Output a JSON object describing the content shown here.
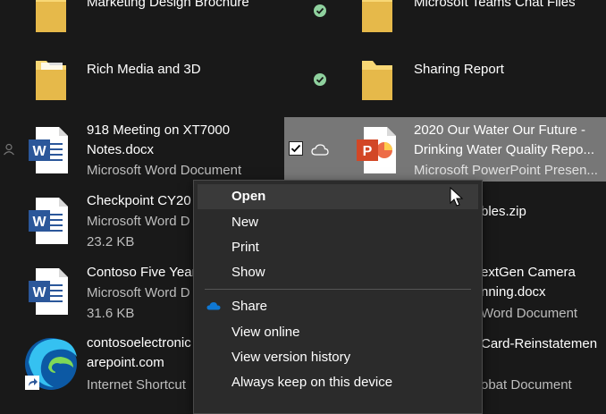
{
  "left_column": {
    "rows": [
      {
        "name_line1": "Marketing Design Brochure"
      },
      {
        "name_line1": "Rich Media and 3D"
      },
      {
        "name_line1": "918 Meeting on XT7000",
        "name_line2": "Notes.docx",
        "type": "Microsoft Word Document"
      },
      {
        "name_line1": "Checkpoint CY20",
        "type": "Microsoft Word D",
        "size": "23.2 KB"
      },
      {
        "name_line1": "Contoso Five Year",
        "type": "Microsoft Word D",
        "size": "31.6 KB"
      },
      {
        "name_line1": "contosoelectronic",
        "name_line2": "arepoint.com",
        "type": "Internet Shortcut"
      }
    ]
  },
  "right_column": {
    "rows": [
      {
        "name_line1": "Microsoft Teams Chat Files"
      },
      {
        "name_line1": "Sharing Report"
      },
      {
        "name_line1": "2020 Our Water Our Future -",
        "name_line2": "Drinking Water Quality Repo...",
        "type": "Microsoft PowerPoint Presen..."
      },
      {
        "name_line1": "bles.zip"
      },
      {
        "name_line1": "extGen Camera",
        "name_line2": "nning.docx",
        "type": "Word Document"
      },
      {
        "name_line1": "Card-Reinstatemen",
        "type": "obat Document"
      }
    ]
  },
  "context_menu": {
    "items": {
      "open": "Open",
      "new": "New",
      "print": "Print",
      "show": "Show",
      "share": "Share",
      "view_online": "View online",
      "view_version_history": "View version history",
      "always_keep": "Always keep on this device"
    }
  },
  "colors": {
    "background": "#191919",
    "selection": "#777777",
    "menu": "#2b2b2b",
    "word_blue": "#2b579a",
    "ppt_orange": "#d24726",
    "folder_yellow": "#f8d775",
    "check_green": "#8fd19e",
    "onedrive_blue": "#0f78d4"
  }
}
